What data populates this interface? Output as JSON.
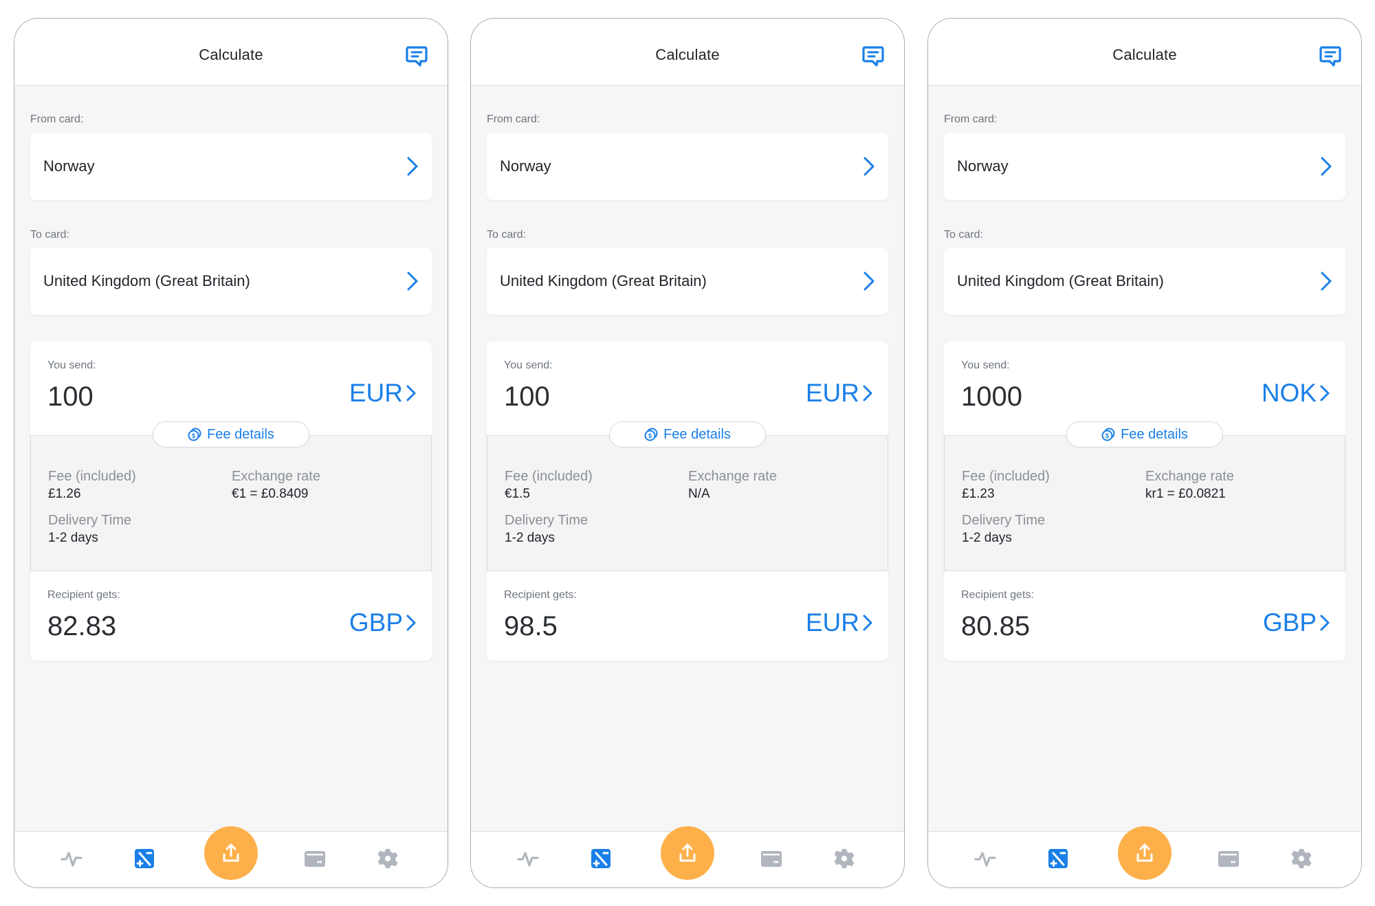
{
  "colors": {
    "accent": "#1a7fe8",
    "fab": "#fdb04a",
    "nav_inactive": "#b1b6be",
    "background": "#f6f6f7"
  },
  "screens": [
    {
      "header": {
        "title": "Calculate",
        "action_icon": "chat-icon"
      },
      "from_card": {
        "label": "From card:",
        "value": "Norway"
      },
      "to_card": {
        "label": "To card:",
        "value": "United Kingdom (Great Britain)"
      },
      "send": {
        "label": "You send:",
        "amount": "100",
        "currency": "EUR"
      },
      "fee_details": {
        "button_label": "Fee details",
        "fee_label": "Fee (included)",
        "fee_value": "£1.26",
        "rate_label": "Exchange rate",
        "rate_value": "€1 =  £0.8409",
        "delivery_label": "Delivery Time",
        "delivery_value": "1-2 days"
      },
      "receive": {
        "label": "Recipient gets:",
        "amount": "82.83",
        "currency": "GBP"
      }
    },
    {
      "header": {
        "title": "Calculate",
        "action_icon": "chat-icon"
      },
      "from_card": {
        "label": "From card:",
        "value": "Norway"
      },
      "to_card": {
        "label": "To card:",
        "value": "United Kingdom (Great Britain)"
      },
      "send": {
        "label": "You send:",
        "amount": "100",
        "currency": "EUR"
      },
      "fee_details": {
        "button_label": "Fee details",
        "fee_label": "Fee (included)",
        "fee_value": "€1.5",
        "rate_label": "Exchange rate",
        "rate_value": "N/A",
        "delivery_label": "Delivery Time",
        "delivery_value": "1-2 days"
      },
      "receive": {
        "label": "Recipient gets:",
        "amount": "98.5",
        "currency": "EUR"
      }
    },
    {
      "header": {
        "title": "Calculate",
        "action_icon": "chat-icon"
      },
      "from_card": {
        "label": "From card:",
        "value": "Norway"
      },
      "to_card": {
        "label": "To card:",
        "value": "United Kingdom (Great Britain)"
      },
      "send": {
        "label": "You send:",
        "amount": "1000",
        "currency": "NOK"
      },
      "fee_details": {
        "button_label": "Fee details",
        "fee_label": "Fee (included)",
        "fee_value": "£1.23",
        "rate_label": "Exchange rate",
        "rate_value": "kr1 =  £0.0821",
        "delivery_label": "Delivery Time",
        "delivery_value": "1-2 days"
      },
      "receive": {
        "label": "Recipient gets:",
        "amount": "80.85",
        "currency": "GBP"
      }
    }
  ],
  "bottom_nav": {
    "items": [
      {
        "icon": "activity-icon",
        "active": false
      },
      {
        "icon": "calculator-icon",
        "active": true
      },
      {
        "icon": "upload-icon",
        "active": false,
        "primary": true
      },
      {
        "icon": "card-icon",
        "active": false
      },
      {
        "icon": "settings-gear-icon",
        "active": false
      }
    ]
  }
}
